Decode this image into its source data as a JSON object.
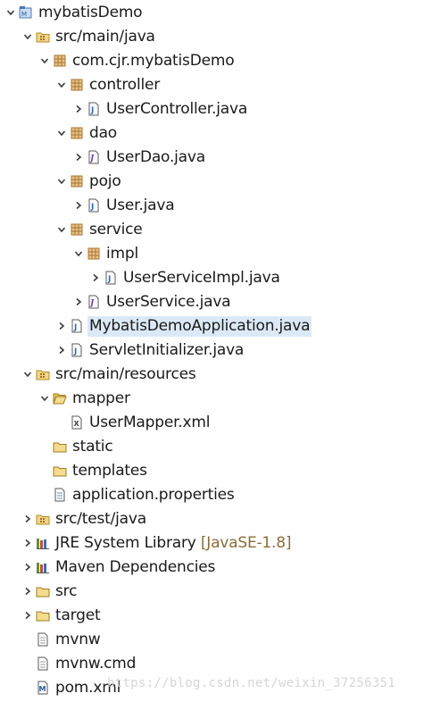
{
  "tree": [
    {
      "label": "mybatisDemo",
      "icon": "project-icon",
      "expanded": true
    },
    {
      "label": "src/main/java",
      "icon": "source-folder-icon",
      "expanded": true
    },
    {
      "label": "com.cjr.mybatisDemo",
      "icon": "package-icon",
      "expanded": true
    },
    {
      "label": "controller",
      "icon": "package-icon",
      "expanded": true
    },
    {
      "label": "UserController.java",
      "icon": "java-class-icon",
      "expanded": false
    },
    {
      "label": "dao",
      "icon": "package-icon",
      "expanded": true
    },
    {
      "label": "UserDao.java",
      "icon": "java-interface-icon",
      "expanded": false
    },
    {
      "label": "pojo",
      "icon": "package-icon",
      "expanded": true
    },
    {
      "label": "User.java",
      "icon": "java-class-icon",
      "expanded": false
    },
    {
      "label": "service",
      "icon": "package-icon",
      "expanded": true
    },
    {
      "label": "impl",
      "icon": "package-icon",
      "expanded": true
    },
    {
      "label": "UserServiceImpl.java",
      "icon": "java-class-icon",
      "expanded": false
    },
    {
      "label": "UserService.java",
      "icon": "java-interface-icon",
      "expanded": false
    },
    {
      "label": "MybatisDemoApplication.java",
      "icon": "java-class-icon",
      "expanded": false,
      "selected": true
    },
    {
      "label": "ServletInitializer.java",
      "icon": "java-class-icon",
      "expanded": false
    },
    {
      "label": "src/main/resources",
      "icon": "source-folder-icon",
      "expanded": true
    },
    {
      "label": "mapper",
      "icon": "folder-open-icon",
      "expanded": true
    },
    {
      "label": "UserMapper.xml",
      "icon": "xml-file-icon"
    },
    {
      "label": "static",
      "icon": "folder-icon"
    },
    {
      "label": "templates",
      "icon": "folder-icon"
    },
    {
      "label": "application.properties",
      "icon": "properties-file-icon"
    },
    {
      "label": "src/test/java",
      "icon": "source-folder-icon",
      "expanded": false
    },
    {
      "label": "JRE System Library",
      "suffix": "[JavaSE-1.8]",
      "icon": "library-icon",
      "expanded": false
    },
    {
      "label": "Maven Dependencies",
      "icon": "library-icon",
      "expanded": false
    },
    {
      "label": "src",
      "icon": "folder-icon",
      "expanded": false
    },
    {
      "label": "target",
      "icon": "folder-icon",
      "expanded": false
    },
    {
      "label": "mvnw",
      "icon": "text-file-icon"
    },
    {
      "label": "mvnw.cmd",
      "icon": "text-file-icon"
    },
    {
      "label": "pom.xml",
      "icon": "maven-pom-icon"
    }
  ],
  "watermark": "https://blog.csdn.net/weixin_37256351",
  "colors": {
    "selection": "#dbe9f7",
    "package": "#b07a2a",
    "java_class": "#2a6cc7",
    "folder": "#e6c15a",
    "suffix": "#8a6d3b"
  }
}
